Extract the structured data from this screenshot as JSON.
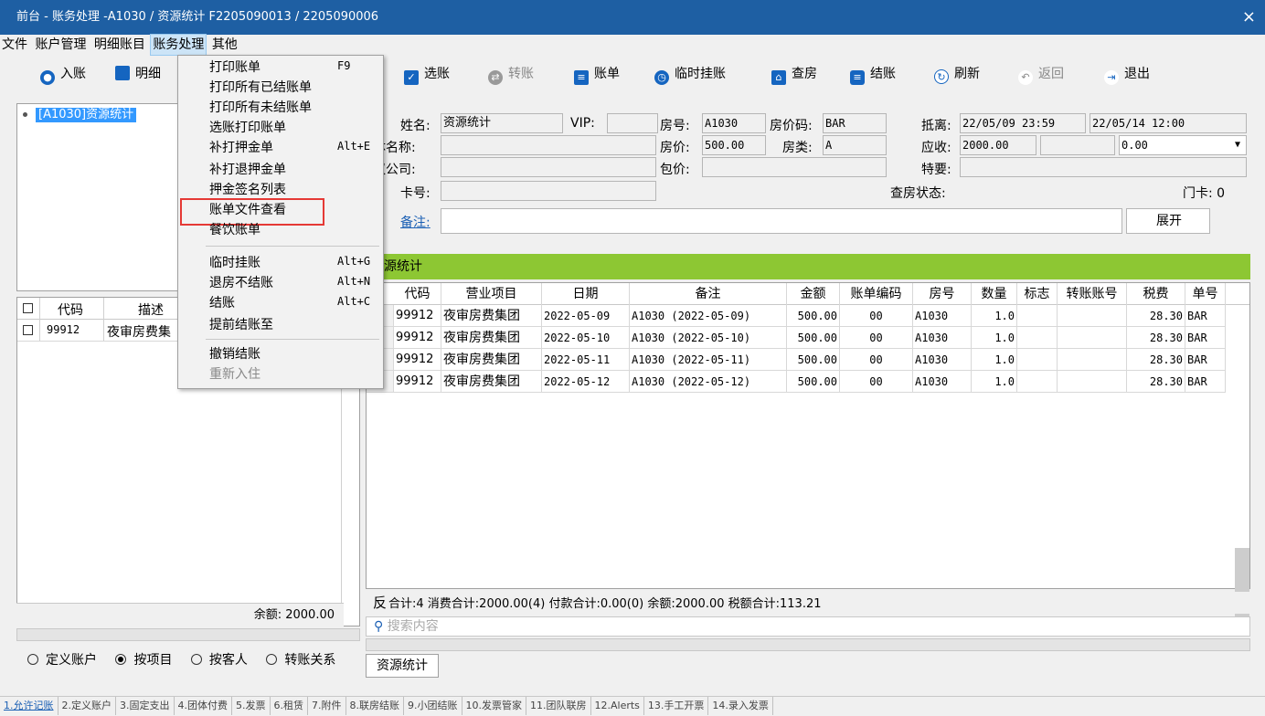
{
  "window": {
    "title": "前台 - 账务处理 -A1030 / 资源统计 F2205090013 / 2205090006",
    "close_glyph": "×"
  },
  "menubar": [
    "文件",
    "账户管理",
    "明细账目",
    "账务处理",
    "其他"
  ],
  "toolbar": {
    "in_account": "入账",
    "detail": "明细",
    "select_account": "选账",
    "transfer": "转账",
    "bill": "账单",
    "temp_hang": "临时挂账",
    "check_room": "查房",
    "checkout": "结账",
    "refresh": "刷新",
    "back": "返回",
    "exit": "退出"
  },
  "tree": {
    "item": "[A1030]资源统计"
  },
  "left_table": {
    "headers": [
      "代码",
      "描述"
    ],
    "rows": [
      {
        "code": "99912",
        "desc": "夜审房费集"
      }
    ],
    "balance": "余额: 2000.00"
  },
  "radios": {
    "options": [
      "定义账户",
      "按项目",
      "按客人",
      "转账关系"
    ],
    "selected": "按项目"
  },
  "info": {
    "name_label": "姓名:",
    "name": "资源统计",
    "vip_label": "VIP:",
    "vip": "",
    "room_label": "房号:",
    "room": "A1030",
    "rate_code_label": "房价码:",
    "rate_code": "BAR",
    "arrival_label": "抵离:",
    "arrival": "22/05/09 23:59",
    "departure": "22/05/14 12:00",
    "group_label": "体名称:",
    "price_label": "房价:",
    "price": "500.00",
    "room_type_label": "房类:",
    "room_type": "A",
    "receivable_label": "应收:",
    "receivable": "2000.00",
    "receivable_extra": "0.00",
    "company_label": "议公司:",
    "package_label": "包价:",
    "special_label": "特要:",
    "card_label": "卡号:",
    "check_status_label": "查房状态:",
    "door_card": "门卡: 0",
    "remark_label": "备注:",
    "expand_button": "展开"
  },
  "grid": {
    "caption": "源统计",
    "headers": [
      "代码",
      "营业项目",
      "日期",
      "备注",
      "金额",
      "账单编码",
      "房号",
      "数量",
      "标志",
      "转账账号",
      "税费",
      "单号"
    ],
    "rows": [
      [
        "99912",
        "夜审房费集团",
        "2022-05-09",
        "A1030 (2022-05-09)",
        "500.00",
        "00",
        "A1030",
        "1.0",
        "",
        "",
        "28.30",
        "BAR"
      ],
      [
        "99912",
        "夜审房费集团",
        "2022-05-10",
        "A1030 (2022-05-10)",
        "500.00",
        "00",
        "A1030",
        "1.0",
        "",
        "",
        "28.30",
        "BAR"
      ],
      [
        "99912",
        "夜审房费集团",
        "2022-05-11",
        "A1030 (2022-05-11)",
        "500.00",
        "00",
        "A1030",
        "1.0",
        "",
        "",
        "28.30",
        "BAR"
      ],
      [
        "99912",
        "夜审房费集团",
        "2022-05-12",
        "A1030 (2022-05-12)",
        "500.00",
        "00",
        "A1030",
        "1.0",
        "",
        "",
        "28.30",
        "BAR"
      ]
    ]
  },
  "summary": {
    "reverse": "反",
    "text": "合计:4  消费合计:2000.00(4)  付款合计:0.00(0)  余额:2000.00  税额合计:113.21"
  },
  "search": {
    "placeholder": "搜索内容"
  },
  "bottom_tab": "资源统计",
  "statusbar": [
    "1.允许记账",
    "2.定义账户",
    "3.固定支出",
    "4.团体付费",
    "5.发票",
    "6.租赁",
    "7.附件",
    "8.联房结账",
    "9.小团结账",
    "10.发票管家",
    "11.团队联房",
    "12.Alerts",
    "13.手工开票",
    "14.录入发票"
  ],
  "dropdown": {
    "items": [
      {
        "label": "打印账单",
        "key": "F9"
      },
      {
        "label": "打印所有已结账单",
        "key": ""
      },
      {
        "label": "打印所有未结账单",
        "key": ""
      },
      {
        "label": "选账打印账单",
        "key": ""
      },
      {
        "label": "补打押金单",
        "key": "Alt+E"
      },
      {
        "label": "补打退押金单",
        "key": ""
      },
      {
        "label": "押金签名列表",
        "key": ""
      },
      {
        "label": "账单文件查看",
        "key": ""
      },
      {
        "label": "餐饮账单",
        "key": ""
      },
      {
        "label": "临时挂账",
        "key": "Alt+G"
      },
      {
        "label": "退房不结账",
        "key": "Alt+N"
      },
      {
        "label": "结账",
        "key": "Alt+C"
      },
      {
        "label": "提前结账至",
        "key": ""
      },
      {
        "label": "撤销结账",
        "key": ""
      },
      {
        "label": "重新入住",
        "key": ""
      }
    ],
    "highlighted": "账单文件查看"
  }
}
